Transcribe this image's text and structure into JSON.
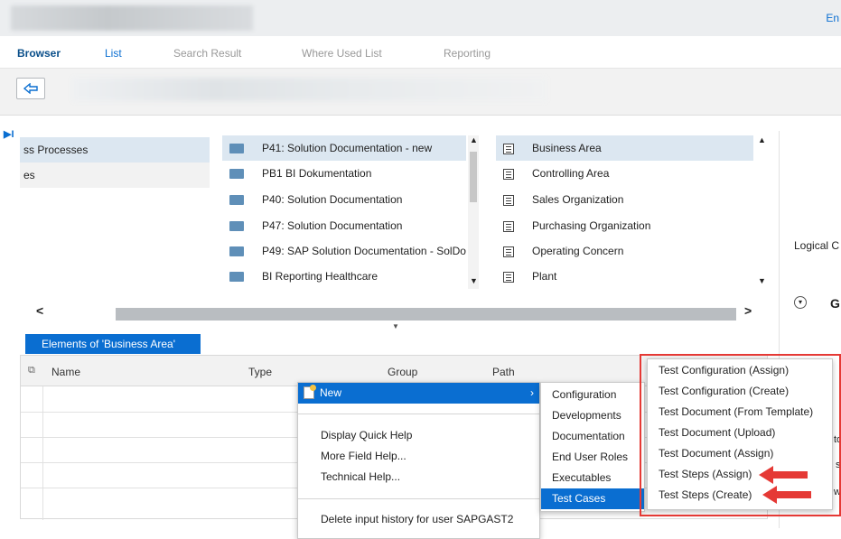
{
  "header": {
    "lang": "En"
  },
  "tabs": [
    "Browser",
    "List",
    "Search Result",
    "Where Used List",
    "Reporting"
  ],
  "panel_a": {
    "rows": [
      "ss Processes",
      "es"
    ]
  },
  "panel_b": {
    "rows": [
      "P41: Solution Documentation - new",
      "PB1 BI Dokumentation",
      "P40: Solution Documentation",
      "P47: Solution Documentation",
      "P49: SAP Solution Documentation - SolDoc",
      "BI Reporting Healthcare"
    ]
  },
  "panel_c": {
    "rows": [
      "Business Area",
      "Controlling Area",
      "Sales Organization",
      "Purchasing Organization",
      "Operating Concern",
      "Plant"
    ]
  },
  "right_panel": {
    "label": "Logical C",
    "glyph": "G",
    "cut_letters": [
      "to",
      "s",
      "w"
    ]
  },
  "elements_tab": "Elements of 'Business Area'",
  "grid": {
    "columns": [
      "Name",
      "Type",
      "Group",
      "Path"
    ]
  },
  "context_menu": {
    "items": [
      "New",
      "Display Quick Help",
      "More Field Help...",
      "Technical Help...",
      "Delete input history for user SAPGAST2"
    ]
  },
  "submenu_new": {
    "items": [
      "Configuration",
      "Developments",
      "Documentation",
      "End User Roles",
      "Executables",
      "Test Cases"
    ]
  },
  "submenu_testcases": {
    "items": [
      "Test Configuration (Assign)",
      "Test Configuration (Create)",
      "Test Document (From Template)",
      "Test Document (Upload)",
      "Test Document (Assign)",
      "Test Steps (Assign)",
      "Test Steps (Create)"
    ]
  },
  "colors": {
    "accent": "#0a6ed1",
    "highlight": "#e53935"
  }
}
